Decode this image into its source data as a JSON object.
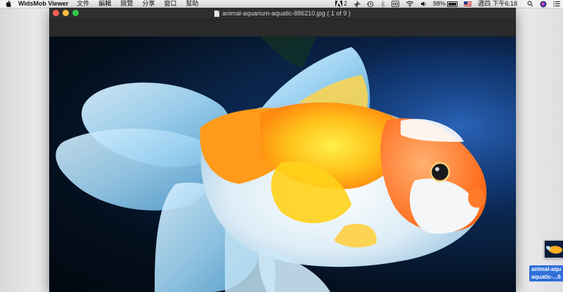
{
  "menubar": {
    "app_name": "WidsMob Viewer",
    "menus": [
      "文件",
      "編輯",
      "閱覽",
      "分享",
      "窗口",
      "幫助"
    ],
    "status": {
      "adobe_badge": "2",
      "battery": "98%",
      "battery_level": 0.98,
      "clock": "週四 下午6:18"
    }
  },
  "window": {
    "title": "animal-aquarium-aquatic-886210.jpg ( 1 of 9 )"
  },
  "desktop": {
    "thumbnail_label_line1": "animal-aqu",
    "thumbnail_label_line2": "aquatic-...6"
  },
  "colors": {
    "menubar_bg": "#f2f2f2",
    "window_bg": "#2b2b2b",
    "close": "#fc605b",
    "minimize": "#fdbc40",
    "zoom": "#34c84a",
    "selection_blue": "#2f6fd8"
  }
}
